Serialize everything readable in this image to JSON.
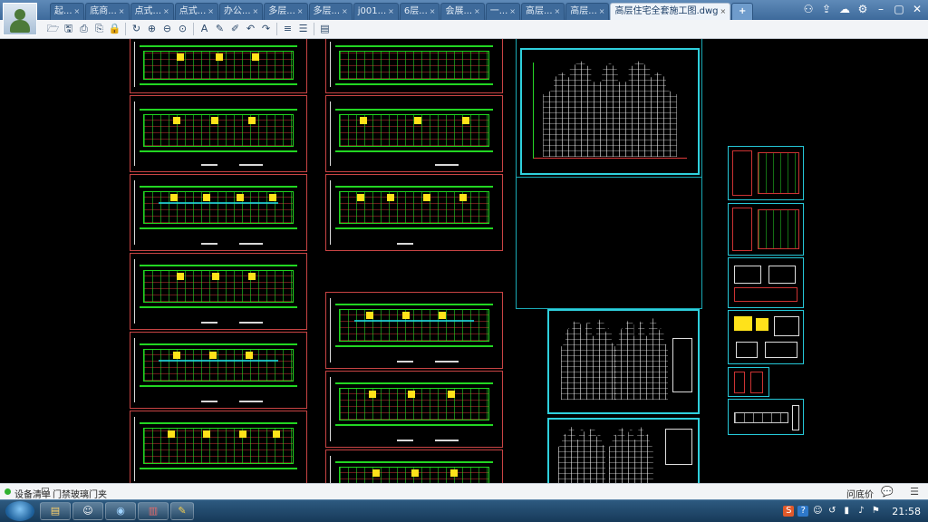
{
  "window": {
    "tabs": [
      {
        "label": "起...",
        "close": "×"
      },
      {
        "label": "底商...",
        "close": "×"
      },
      {
        "label": "点式...",
        "close": "×"
      },
      {
        "label": "点式...",
        "close": "×"
      },
      {
        "label": "办公...",
        "close": "×"
      },
      {
        "label": "多层...",
        "close": "×"
      },
      {
        "label": "多层...",
        "close": "×"
      },
      {
        "label": "j001...",
        "close": "×"
      },
      {
        "label": "6层...",
        "close": "×"
      },
      {
        "label": "会展...",
        "close": "×"
      },
      {
        "label": "一...",
        "close": "×"
      },
      {
        "label": "高层...",
        "close": "×"
      },
      {
        "label": "高层...",
        "close": "×"
      }
    ],
    "active_tab": {
      "label": "高层住宅全套施工图.dwg",
      "close": "×"
    },
    "add_tab_label": "+",
    "right_icons": [
      "users-icon",
      "share-icon",
      "cloud-icon",
      "settings-icon"
    ]
  },
  "toolbar": {
    "icons": [
      "open-icon",
      "save-icon",
      "print-icon",
      "print-preview-icon",
      "lock-icon",
      "pan-icon",
      "zoom-window-icon",
      "zoom-icon",
      "zoom-extents-icon",
      "text-icon",
      "pen-icon",
      "markup-icon",
      "undo-icon",
      "redo-icon",
      "layer-icon",
      "layers-icon",
      "properties-icon"
    ],
    "glyphs": [
      "🗁",
      "🖫",
      "⎙",
      "⎘",
      "🔒",
      "↻",
      "⊕",
      "⊖",
      "⊙",
      "A",
      "✎",
      "✐",
      "↶",
      "↷",
      "≡",
      "☰",
      "▤"
    ]
  },
  "statusbar": {
    "left_text": "设备清单",
    "right_text": "门禁玻璃门夹",
    "help_text": "问底价"
  },
  "taskbar": {
    "clock": "21:58",
    "apps": [
      "explorer-icon",
      "qq-icon",
      "browser-icon",
      "winrar-icon",
      "cad-viewer-icon"
    ],
    "tray_icons": [
      "s-icon",
      "help-icon",
      "person-icon",
      "back-icon",
      "network-icon",
      "volume-icon",
      "flag-icon"
    ]
  },
  "colors": {
    "canvas": "#000000",
    "sheet_frame_red": "#c94444",
    "sheet_frame_cyan": "#25c8d8",
    "plan_green": "#1fd61f",
    "highlight_yellow": "#ffe21a"
  }
}
